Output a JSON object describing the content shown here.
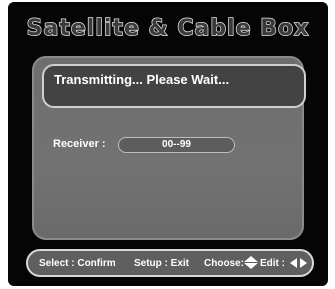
{
  "header": {
    "title": "Satellite & Cable Box"
  },
  "status": {
    "message": "Transmitting... Please Wait..."
  },
  "receiver": {
    "label": "Receiver :",
    "value": "00--99"
  },
  "footer": {
    "select_hint": "Select : Confirm",
    "setup_hint": "Setup : Exit",
    "choose_label": "Choose:",
    "edit_label": "Edit :",
    "icons": [
      "up-down-arrows-icon",
      "left-right-arrows-icon"
    ]
  },
  "colors": {
    "screen_background": "#050505",
    "panel": "#6e6e6e",
    "status_box": "#434343",
    "footer_bar": "#5f5f5f",
    "text": "#ffffff"
  }
}
